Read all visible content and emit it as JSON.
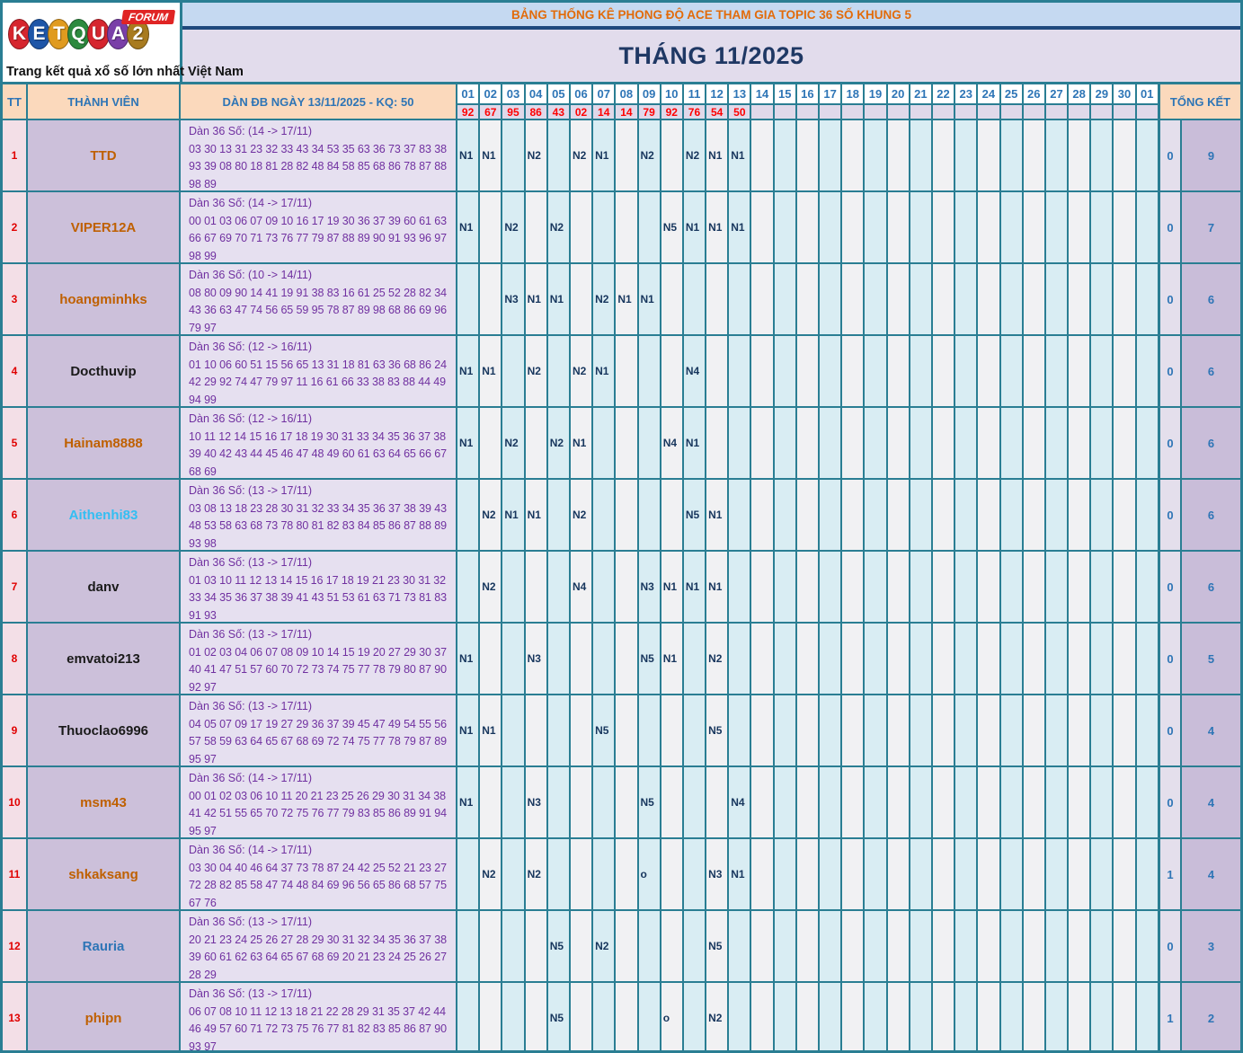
{
  "logo": {
    "letters": [
      {
        "ch": "K",
        "color": "#d6252e"
      },
      {
        "ch": "E",
        "color": "#1e56a8"
      },
      {
        "ch": "T",
        "color": "#e09b1f"
      },
      {
        "ch": "Q",
        "color": "#2c8a3e"
      },
      {
        "ch": "U",
        "color": "#d6252e"
      },
      {
        "ch": "A",
        "color": "#7a3fa8"
      },
      {
        "ch": "2",
        "color": "#a87b1f"
      }
    ],
    "forum_badge": "FORUM",
    "tagline": "Trang kết quả xổ số lớn nhất Việt Nam"
  },
  "banner": {
    "text": "BẢNG THỐNG KÊ PHONG ĐỘ ACE THAM GIA TOPIC 36 SỐ KHUNG 5"
  },
  "title": {
    "text": "THÁNG 11/2025"
  },
  "colors": {
    "border_teal": "#2a7e93",
    "banner_bg": "#c5d9f1",
    "banner_text": "#e26b0a",
    "title_text": "#1f3864",
    "header_bg": "#fbd9bc",
    "header_text": "#2e75b6",
    "kq_text": "#ff0000",
    "mark_text": "#17365d",
    "dan_text": "#7030a0",
    "name_brown": "#bf6000",
    "name_cyan": "#33bef2",
    "name_blue": "#2e75b6"
  },
  "table": {
    "headers": {
      "tt": "TT",
      "member": "THÀNH VIÊN",
      "dan": "DÀN ĐB NGÀY 13/11/2025 - KQ: 50",
      "total": "TỔNG KẾT"
    },
    "days": [
      "01",
      "02",
      "03",
      "04",
      "05",
      "06",
      "07",
      "08",
      "09",
      "10",
      "11",
      "12",
      "13",
      "14",
      "15",
      "16",
      "17",
      "18",
      "19",
      "20",
      "21",
      "22",
      "23",
      "24",
      "25",
      "26",
      "27",
      "28",
      "29",
      "30",
      "01"
    ],
    "kq": [
      "92",
      "67",
      "95",
      "86",
      "43",
      "02",
      "14",
      "14",
      "79",
      "92",
      "76",
      "54",
      "50"
    ],
    "rows": [
      {
        "tt": "1",
        "member": "TTD",
        "name_color": "brown",
        "dan_label": "Dàn 36 Số: (14 -> 17/11)",
        "dan_numbers": "03 30 13 31 23 32 33 43 34 53 35 63 36 73 37 83 38 93 39 08 80 18 81 28 82 48 84 58 85 68 86 78 87 88 98 89",
        "marks": {
          "1": "N1",
          "2": "N1",
          "4": "N2",
          "6": "N2",
          "7": "N1",
          "9": "N2",
          "11": "N2",
          "12": "N1",
          "13": "N1"
        },
        "total1": "0",
        "total2": "9"
      },
      {
        "tt": "2",
        "member": "VIPER12A",
        "name_color": "brown",
        "dan_label": "Dàn 36 Số: (14 -> 17/11)",
        "dan_numbers": "00 01 03 06 07 09 10 16 17 19 30 36 37 39 60 61 63 66 67 69 70 71 73 76 77 79 87 88 89 90 91 93 96 97 98 99",
        "marks": {
          "1": "N1",
          "3": "N2",
          "5": "N2",
          "10": "N5",
          "11": "N1",
          "12": "N1",
          "13": "N1"
        },
        "total1": "0",
        "total2": "7"
      },
      {
        "tt": "3",
        "member": "hoangminhks",
        "name_color": "brown",
        "dan_label": "Dàn 36 Số: (10 -> 14/11)",
        "dan_numbers": "08 80 09 90 14 41 19 91 38 83 16 61 25 52 28 82 34 43 36 63 47 74 56 65 59 95 78 87 89 98 68 86 69 96 79 97",
        "marks": {
          "3": "N3",
          "4": "N1",
          "5": "N1",
          "7": "N2",
          "8": "N1",
          "9": "N1"
        },
        "total1": "0",
        "total2": "6"
      },
      {
        "tt": "4",
        "member": "Docthuvip",
        "name_color": "black",
        "dan_label": "Dàn 36 Số: (12 -> 16/11)",
        "dan_numbers": "01 10 06 60 51 15 56 65 13 31 18 81 63 36 68 86 24 42 29 92 74 47 79 97 11 16 61 66 33 38 83 88 44 49 94 99",
        "marks": {
          "1": "N1",
          "2": "N1",
          "4": "N2",
          "6": "N2",
          "7": "N1",
          "11": "N4"
        },
        "total1": "0",
        "total2": "6"
      },
      {
        "tt": "5",
        "member": "Hainam8888",
        "name_color": "brown",
        "dan_label": "Dàn 36 Số: (12 -> 16/11)",
        "dan_numbers": "10 11 12 14 15 16 17 18 19 30 31 33 34 35 36 37 38 39 40 42 43 44 45 46 47 48 49 60 61 63 64 65 66 67 68 69",
        "marks": {
          "1": "N1",
          "3": "N2",
          "5": "N2",
          "6": "N1",
          "10": "N4",
          "11": "N1"
        },
        "total1": "0",
        "total2": "6"
      },
      {
        "tt": "6",
        "member": "Aithenhi83",
        "name_color": "cyan",
        "dan_label": "Dàn 36 Số: (13 -> 17/11)",
        "dan_numbers": "03 08 13 18 23 28 30 31 32 33 34 35 36 37 38 39 43 48 53 58 63 68 73 78 80 81 82 83 84 85 86 87 88 89 93 98",
        "marks": {
          "2": "N2",
          "3": "N1",
          "4": "N1",
          "6": "N2",
          "11": "N5",
          "12": "N1"
        },
        "total1": "0",
        "total2": "6"
      },
      {
        "tt": "7",
        "member": "danv",
        "name_color": "black",
        "dan_label": "Dàn 36 Số: (13 -> 17/11)",
        "dan_numbers": "01 03 10 11 12 13 14 15 16 17 18 19 21 23 30 31 32 33 34 35 36 37 38 39 41 43 51 53 61 63 71 73 81 83 91 93",
        "marks": {
          "2": "N2",
          "6": "N4",
          "9": "N3",
          "10": "N1",
          "11": "N1",
          "12": "N1"
        },
        "total1": "0",
        "total2": "6"
      },
      {
        "tt": "8",
        "member": "emvatoi213",
        "name_color": "black",
        "dan_label": "Dàn 36 Số: (13 -> 17/11)",
        "dan_numbers": "01 02 03 04 06 07 08 09 10 14 15 19 20 27 29 30 37 40 41 47 51 57 60 70 72 73 74 75 77 78 79 80 87 90 92 97",
        "marks": {
          "1": "N1",
          "4": "N3",
          "9": "N5",
          "10": "N1",
          "12": "N2"
        },
        "total1": "0",
        "total2": "5"
      },
      {
        "tt": "9",
        "member": "Thuoclao6996",
        "name_color": "black",
        "dan_label": "Dàn 36 Số: (13 -> 17/11)",
        "dan_numbers": "04 05 07 09 17 19 27 29 36 37 39 45 47 49 54 55 56 57 58 59 63 64 65 67 68 69 72 74 75 77 78 79 87 89 95 97",
        "marks": {
          "1": "N1",
          "2": "N1",
          "7": "N5",
          "12": "N5"
        },
        "total1": "0",
        "total2": "4"
      },
      {
        "tt": "10",
        "member": "msm43",
        "name_color": "brown",
        "dan_label": "Dàn 36 Số: (14 -> 17/11)",
        "dan_numbers": "00 01 02 03 06 10 11 20 21 23 25 26 29 30 31 34 38 41 42 51 55 65 70 72 75 76 77 79 83 85 86 89 91 94 95 97",
        "marks": {
          "1": "N1",
          "4": "N3",
          "9": "N5",
          "13": "N4"
        },
        "total1": "0",
        "total2": "4"
      },
      {
        "tt": "11",
        "member": "shkaksang",
        "name_color": "brown",
        "dan_label": "Dàn 36 Số: (14 -> 17/11)",
        "dan_numbers": "03 30 04 40 46 64 37 73 78 87 24 42 25 52 21 23 27 72 28 82 85 58 47 74 48 84 69 96 56 65 86 68 57 75 67 76",
        "marks": {
          "2": "N2",
          "4": "N2",
          "9": "o",
          "12": "N3",
          "13": "N1"
        },
        "total1": "1",
        "total2": "4"
      },
      {
        "tt": "12",
        "member": "Rauria",
        "name_color": "blue",
        "dan_label": "Dàn 36 Số: (13 -> 17/11)",
        "dan_numbers": "20 21 23 24 25 26 27 28 29 30 31 32 34 35 36 37 38 39 60 61 62 63 64 65 67 68 69 20 21 23 24 25 26 27 28 29",
        "marks": {
          "5": "N5",
          "7": "N2",
          "12": "N5"
        },
        "total1": "0",
        "total2": "3"
      },
      {
        "tt": "13",
        "member": "phipn",
        "name_color": "brown",
        "dan_label": "Dàn 36 Số: (13 -> 17/11)",
        "dan_numbers": "06 07 08 10 11 12 13 18 21 22 28 29 31 35 37 42 44 46 49 57 60 71 72 73 75 76 77 81 82 83 85 86 87 90 93 97",
        "marks": {
          "5": "N5",
          "10": "o",
          "12": "N2"
        },
        "total1": "1",
        "total2": "2"
      }
    ]
  }
}
